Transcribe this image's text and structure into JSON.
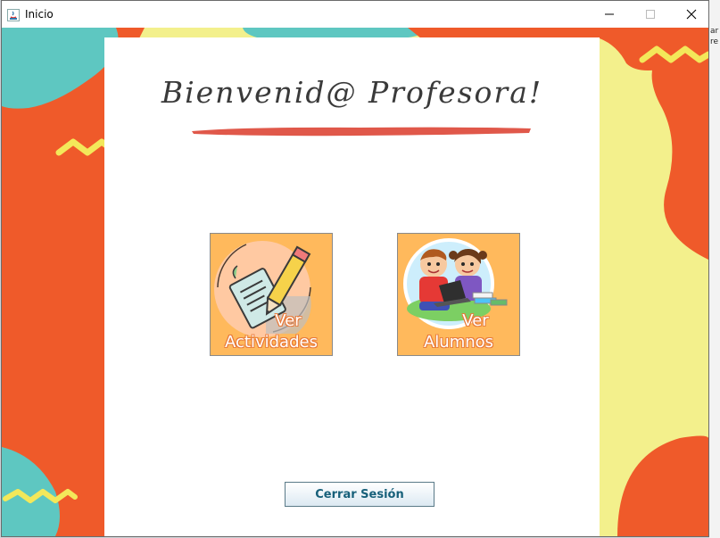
{
  "window": {
    "title": "Inicio",
    "controls": {
      "minimize_icon": "minimize-icon",
      "maximize_icon": "maximize-icon",
      "close_icon": "close-icon"
    }
  },
  "background_desktop": {
    "fragments": [
      "ar",
      "re"
    ]
  },
  "main": {
    "heading": "Bienvenid@ Profesora!",
    "tiles": [
      {
        "label_top": "Ver",
        "label_bottom": "Actividades",
        "icon": "pencil-document-icon"
      },
      {
        "label_top": "Ver",
        "label_bottom": "Alumnos",
        "icon": "students-laptop-icon"
      }
    ],
    "logout_label": "Cerrar Sesión"
  },
  "colors": {
    "orange": "#ef5a2a",
    "teal": "#5ec7c1",
    "yellow": "#f3f08c",
    "tile_bg": "#ffb95c",
    "button_text": "#17607a"
  }
}
